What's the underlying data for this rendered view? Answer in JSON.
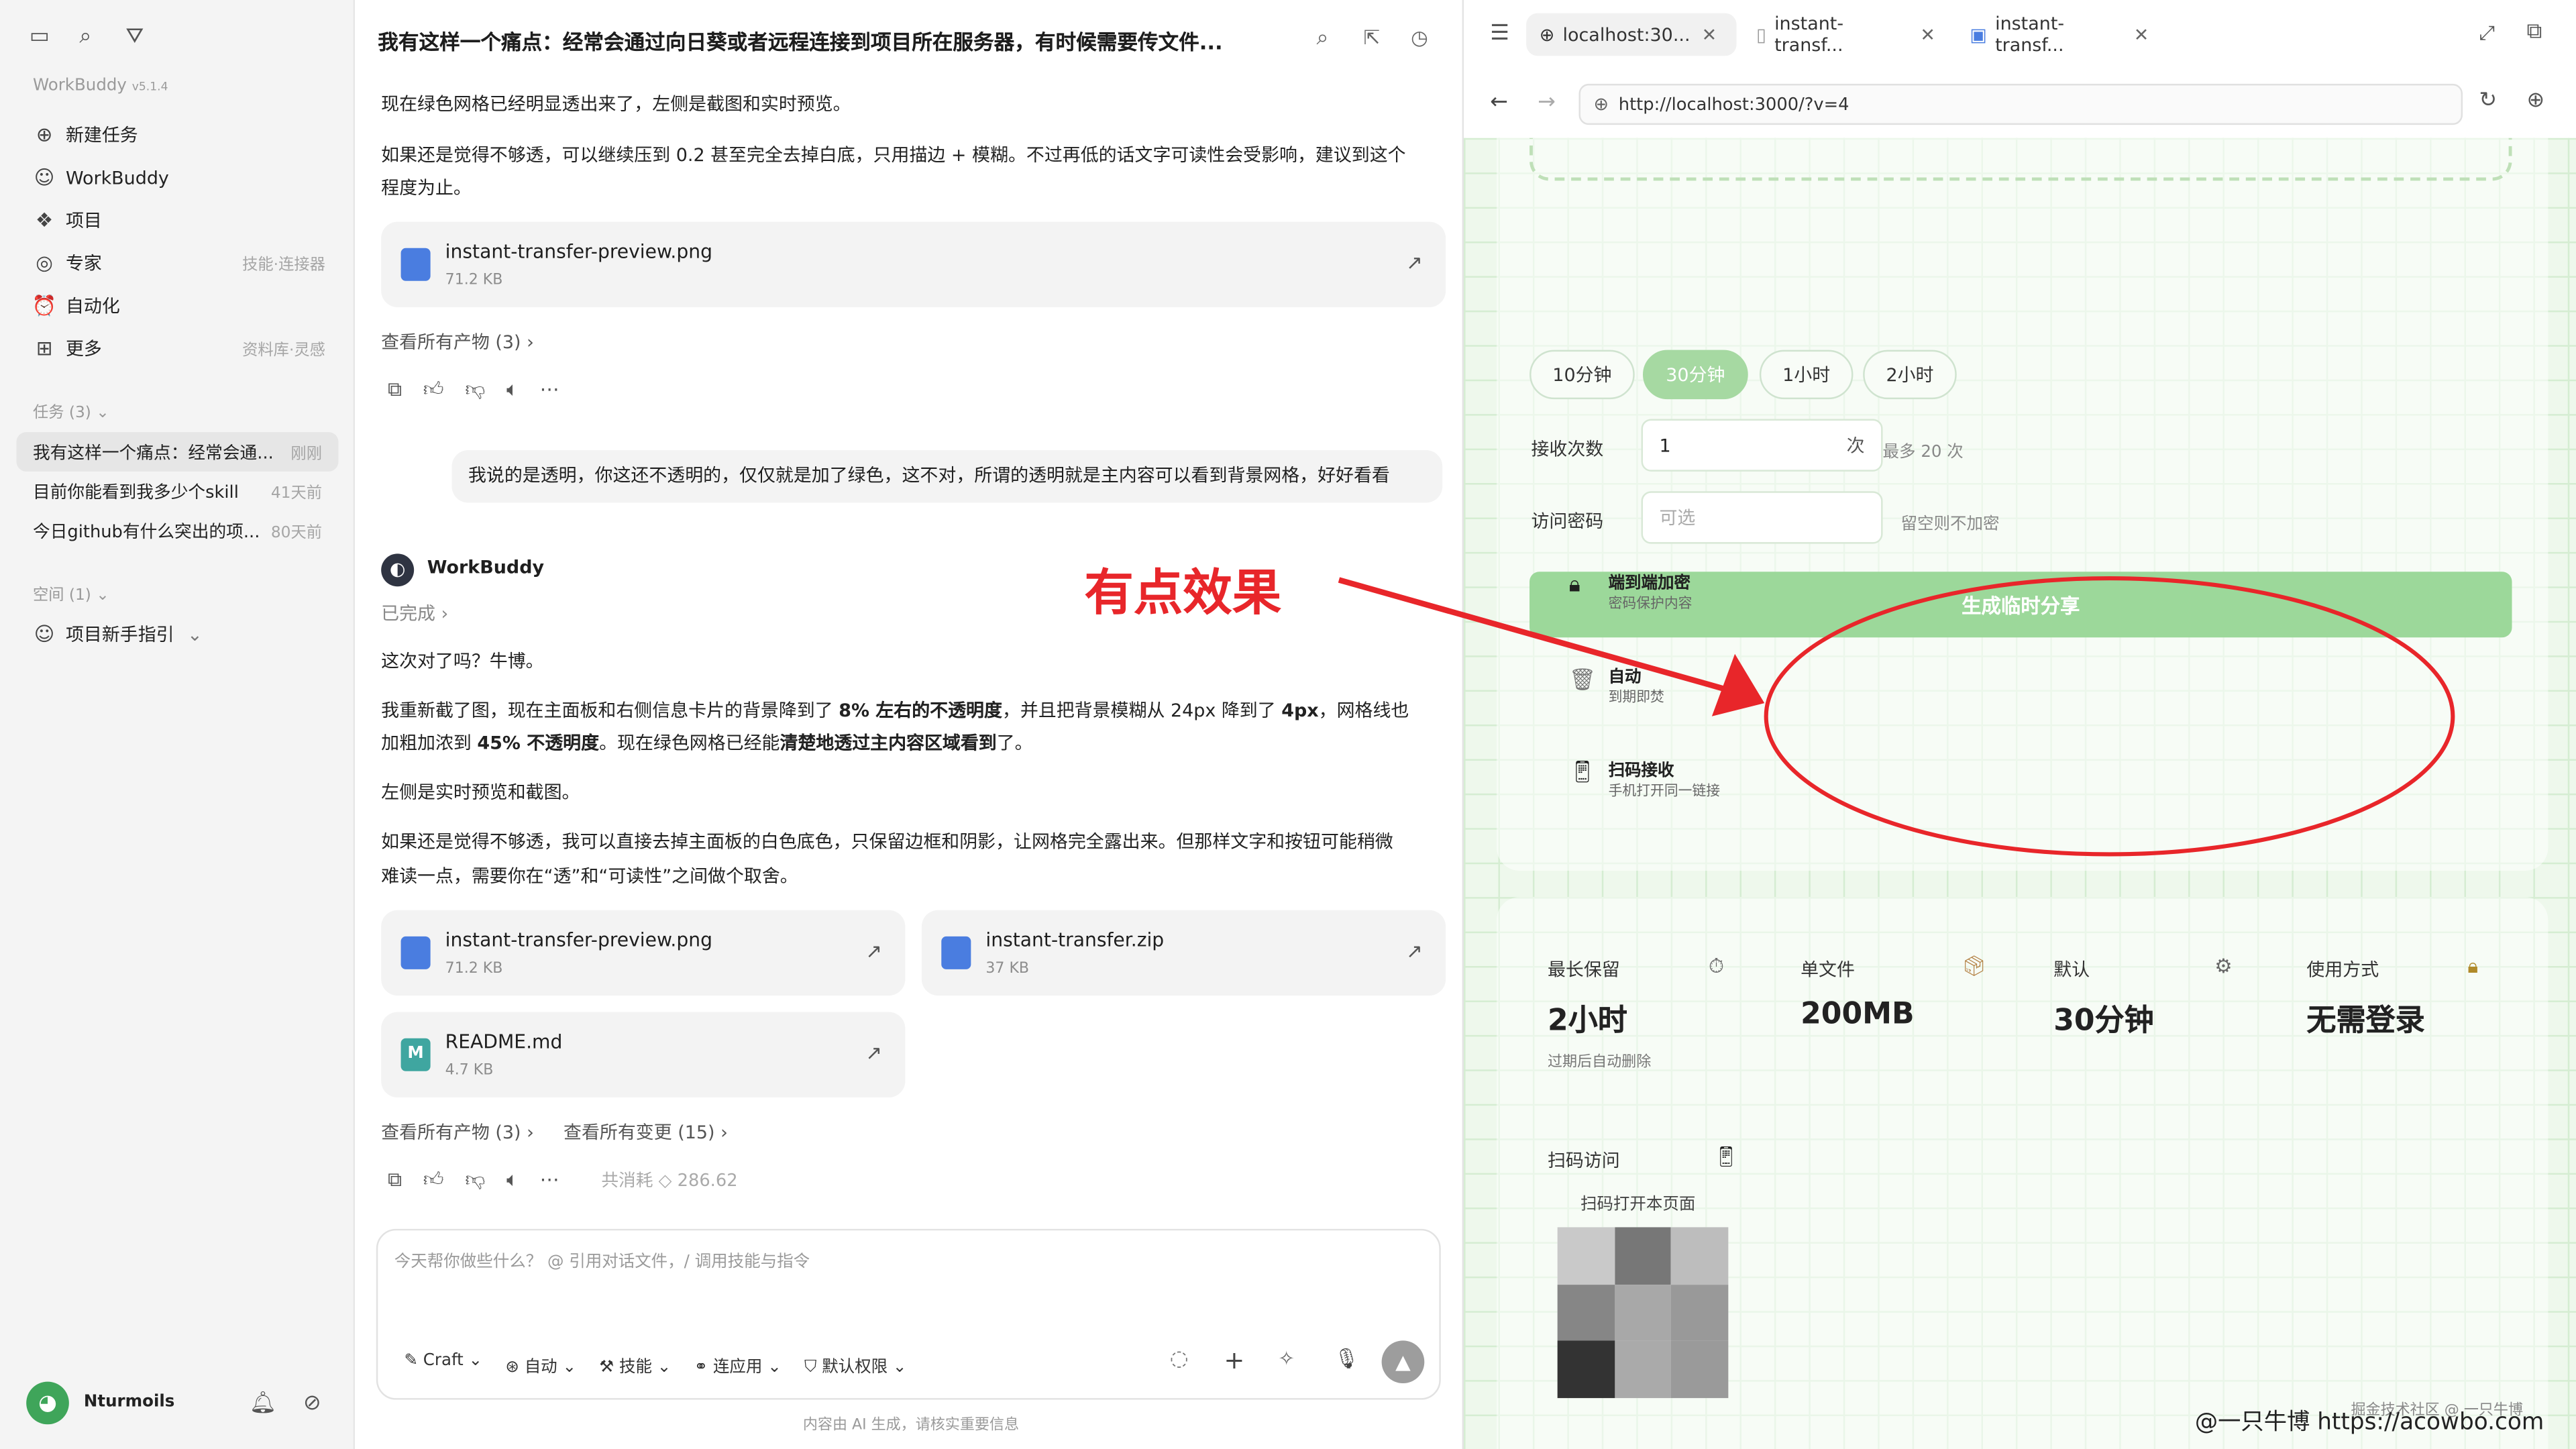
{
  "sidebar": {
    "app_name": "WorkBuddy",
    "version": "v5.1.4",
    "nav": [
      {
        "label": "新建任务",
        "icon": "plus-circle-icon"
      },
      {
        "label": "WorkBuddy",
        "icon": "buddy-icon"
      },
      {
        "label": "项目",
        "icon": "folder-icon"
      },
      {
        "label": "专家",
        "hint": "技能·连接器",
        "icon": "expert-icon"
      },
      {
        "label": "自动化",
        "icon": "alarm-icon"
      },
      {
        "label": "更多",
        "hint": "资料库·灵感",
        "icon": "grid-icon"
      }
    ],
    "tasks_header": "任务 (3)",
    "tasks": [
      {
        "title": "我有这样一个痛点：经常会通...",
        "time": "刚刚"
      },
      {
        "title": "目前你能看到我多少个skill",
        "time": "41天前"
      },
      {
        "title": "今日github有什么突出的项...",
        "time": "80天前"
      }
    ],
    "space_header": "空间 (1)",
    "space_item": "项目新手指引",
    "user": "Nturmoils"
  },
  "chat": {
    "title": "我有这样一个痛点：经常会通过向日葵或者远程连接到项目所在服务器，有时候需要传文件...",
    "p1": "现在绿色网格已经明显透出来了，左侧是截图和实时预览。",
    "p2a": "如果还是觉得不够透，可以继续压到 0.2 甚至完全去掉白底，只用描边 + 模糊。不过再低的话文字可读性会受影响，建议到这个",
    "p2b": "程度为止。",
    "file1": {
      "name": "instant-transfer-preview.png",
      "size": "71.2 KB"
    },
    "view_all_1": "查看所有产物 (3)",
    "user_msg": "我说的是透明，你这还不透明的，仅仅就是加了绿色，这不对，所谓的透明就是主内容可以看到背景网格，好好看看",
    "bot_name": "WorkBuddy",
    "status": "已完成",
    "r1": "这次对了吗？牛博。",
    "r2a": "我重新截了图，现在主面板和右侧信息卡片的背景降到了 ",
    "r2b": "8% 左右的不透明度",
    "r2c": "，并且把背景模糊从 24px 降到了 ",
    "r2d": "4px",
    "r2e": "，网格线也",
    "r2f": "加粗加浓到 ",
    "r2g": "45% 不透明度",
    "r2h": "。现在绿色网格已经能",
    "r2i": "清楚地透过主内容区域看到",
    "r2j": "了。",
    "r3": "左侧是实时预览和截图。",
    "r4a": "如果还是觉得不够透，我可以直接去掉主面板的白色底色，只保留边框和阴影，让网格完全露出来。但那样文字和按钮可能稍微",
    "r4b": "难读一点，需要你在“透”和“可读性”之间做个取舍。",
    "file2": {
      "name": "instant-transfer-preview.png",
      "size": "71.2 KB"
    },
    "file3": {
      "name": "instant-transfer.zip",
      "size": "37 KB"
    },
    "file4": {
      "name": "README.md",
      "size": "4.7 KB"
    },
    "view_all_2": "查看所有产物 (3)",
    "view_changes": "查看所有变更 (15)",
    "tokens": "共消耗 ◇ 286.62",
    "input_placeholder": "今天帮你做些什么？ @ 引用对话文件，/ 调用技能与指令",
    "toolbar": [
      "Craft",
      "自动",
      "技能",
      "连应用",
      "默认权限"
    ],
    "footer": "内容由 AI 生成，请核实重要信息"
  },
  "browser": {
    "tabs": [
      "localhost:30...",
      "instant-transf...",
      "instant-transf..."
    ],
    "url": "http://localhost:3000/?v=4",
    "durations": [
      "10分钟",
      "30分钟",
      "1小时",
      "2小时"
    ],
    "recv_label": "接收次数",
    "recv_value": "1",
    "recv_unit": "次",
    "recv_hint": "最多 20 次",
    "pwd_label": "访问密码",
    "pwd_placeholder": "可选",
    "pwd_hint": "留空则不加密",
    "submit": "生成临时分享",
    "features": [
      {
        "title": "端到端加密",
        "sub": "密码保护内容"
      },
      {
        "title": "自动",
        "sub": "到期即焚"
      },
      {
        "title": "扫码接收",
        "sub": "手机打开同一链接"
      }
    ],
    "stats": [
      {
        "label": "最长保留",
        "value": "2小时",
        "sub": "过期后自动删除"
      },
      {
        "label": "单文件",
        "value": "200MB"
      },
      {
        "label": "默认",
        "value": "30分钟"
      },
      {
        "label": "使用方式",
        "value": "无需登录"
      }
    ],
    "qr_label": "扫码访问",
    "qr_sub": "扫码打开本页面"
  },
  "annotation": "有点效果",
  "watermark1": "掘金技术社区 @ 一只牛博",
  "watermark2": "@一只牛博 https://acowbo.com",
  "colors": {
    "accent_green": "#9cd89a",
    "selected_pill": "#a6d9a2",
    "annotation_red": "#e8262a"
  }
}
